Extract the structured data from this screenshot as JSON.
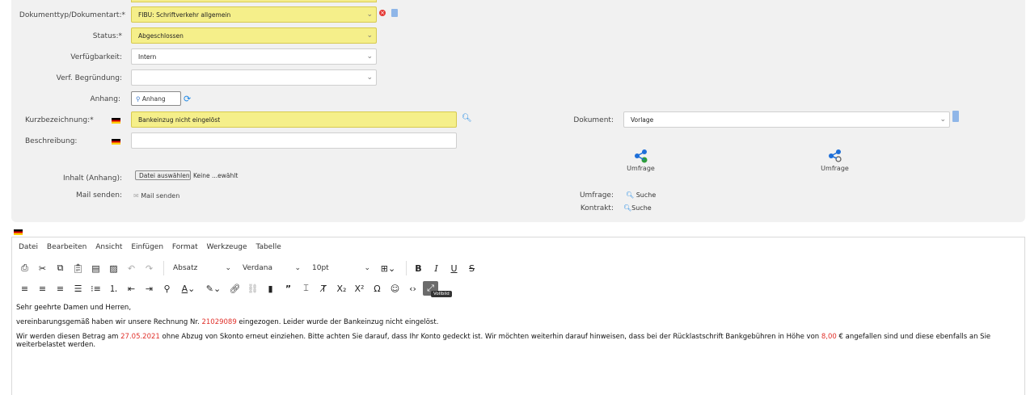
{
  "form": {
    "doctype": {
      "label": "Dokumenttyp/Dokumentart:*",
      "value": "FIBU: Schriftverkehr allgemein"
    },
    "status": {
      "label": "Status:*",
      "value": "Abgeschlossen"
    },
    "availability": {
      "label": "Verfügbarkeit:",
      "value": "Intern"
    },
    "reason": {
      "label": "Verf. Begründung:",
      "value": ""
    },
    "attachment": {
      "label": "Anhang:",
      "button": "Anhang"
    },
    "shortname": {
      "label": "Kurzbezeichnung:*",
      "value": "Bankeinzug nicht eingelöst"
    },
    "description": {
      "label": "Beschreibung:",
      "value": ""
    },
    "content": {
      "label": "Inhalt (Anhang):",
      "button": "Datei auswählen",
      "text": "Keine ...ewählt"
    },
    "mail": {
      "label": "Mail senden:",
      "text": "Mail senden"
    },
    "document": {
      "label": "Dokument:",
      "value": "Vorlage"
    },
    "survey1": {
      "label": "Umfrage"
    },
    "survey2": {
      "label": "Umfrage"
    },
    "survey_search": {
      "label": "Umfrage:",
      "text": "Suche"
    },
    "contract_search": {
      "label": "Kontrakt:",
      "text": "Suche"
    }
  },
  "editor": {
    "menu": [
      "Datei",
      "Bearbeiten",
      "Ansicht",
      "Einfügen",
      "Format",
      "Werkzeuge",
      "Tabelle"
    ],
    "block_format": "Absatz",
    "font_family": "Verdana",
    "font_size": "10pt",
    "tooltip": "Vollbild",
    "body": {
      "greeting": "Sehr geehrte Damen und Herren,",
      "p1_a": "vereinbarungsgemäß haben wir unsere Rechnung Nr. ",
      "p1_invoice": "21029089",
      "p1_b": " eingezogen. Leider wurde der Bankeinzug nicht eingelöst.",
      "p2_a": "Wir werden diesen Betrag am ",
      "p2_date": "27.05.2021",
      "p2_b": " ohne Abzug von Skonto erneut einziehen. Bitte achten Sie darauf, dass Ihr Konto gedeckt ist. Wir möchten weiterhin darauf hinweisen, dass bei der Rücklastschrift Bankgebühren in Höhe von ",
      "p2_amount": "8,00",
      "p2_c": " € angefallen sind und diese ebenfalls an Sie weiterbelastet werden."
    }
  },
  "colors": {
    "required_bg": "#f5ef8a",
    "highlight_red": "#e0302a",
    "link_blue": "#1e88e5",
    "panel_bg": "#f1f1f1"
  }
}
